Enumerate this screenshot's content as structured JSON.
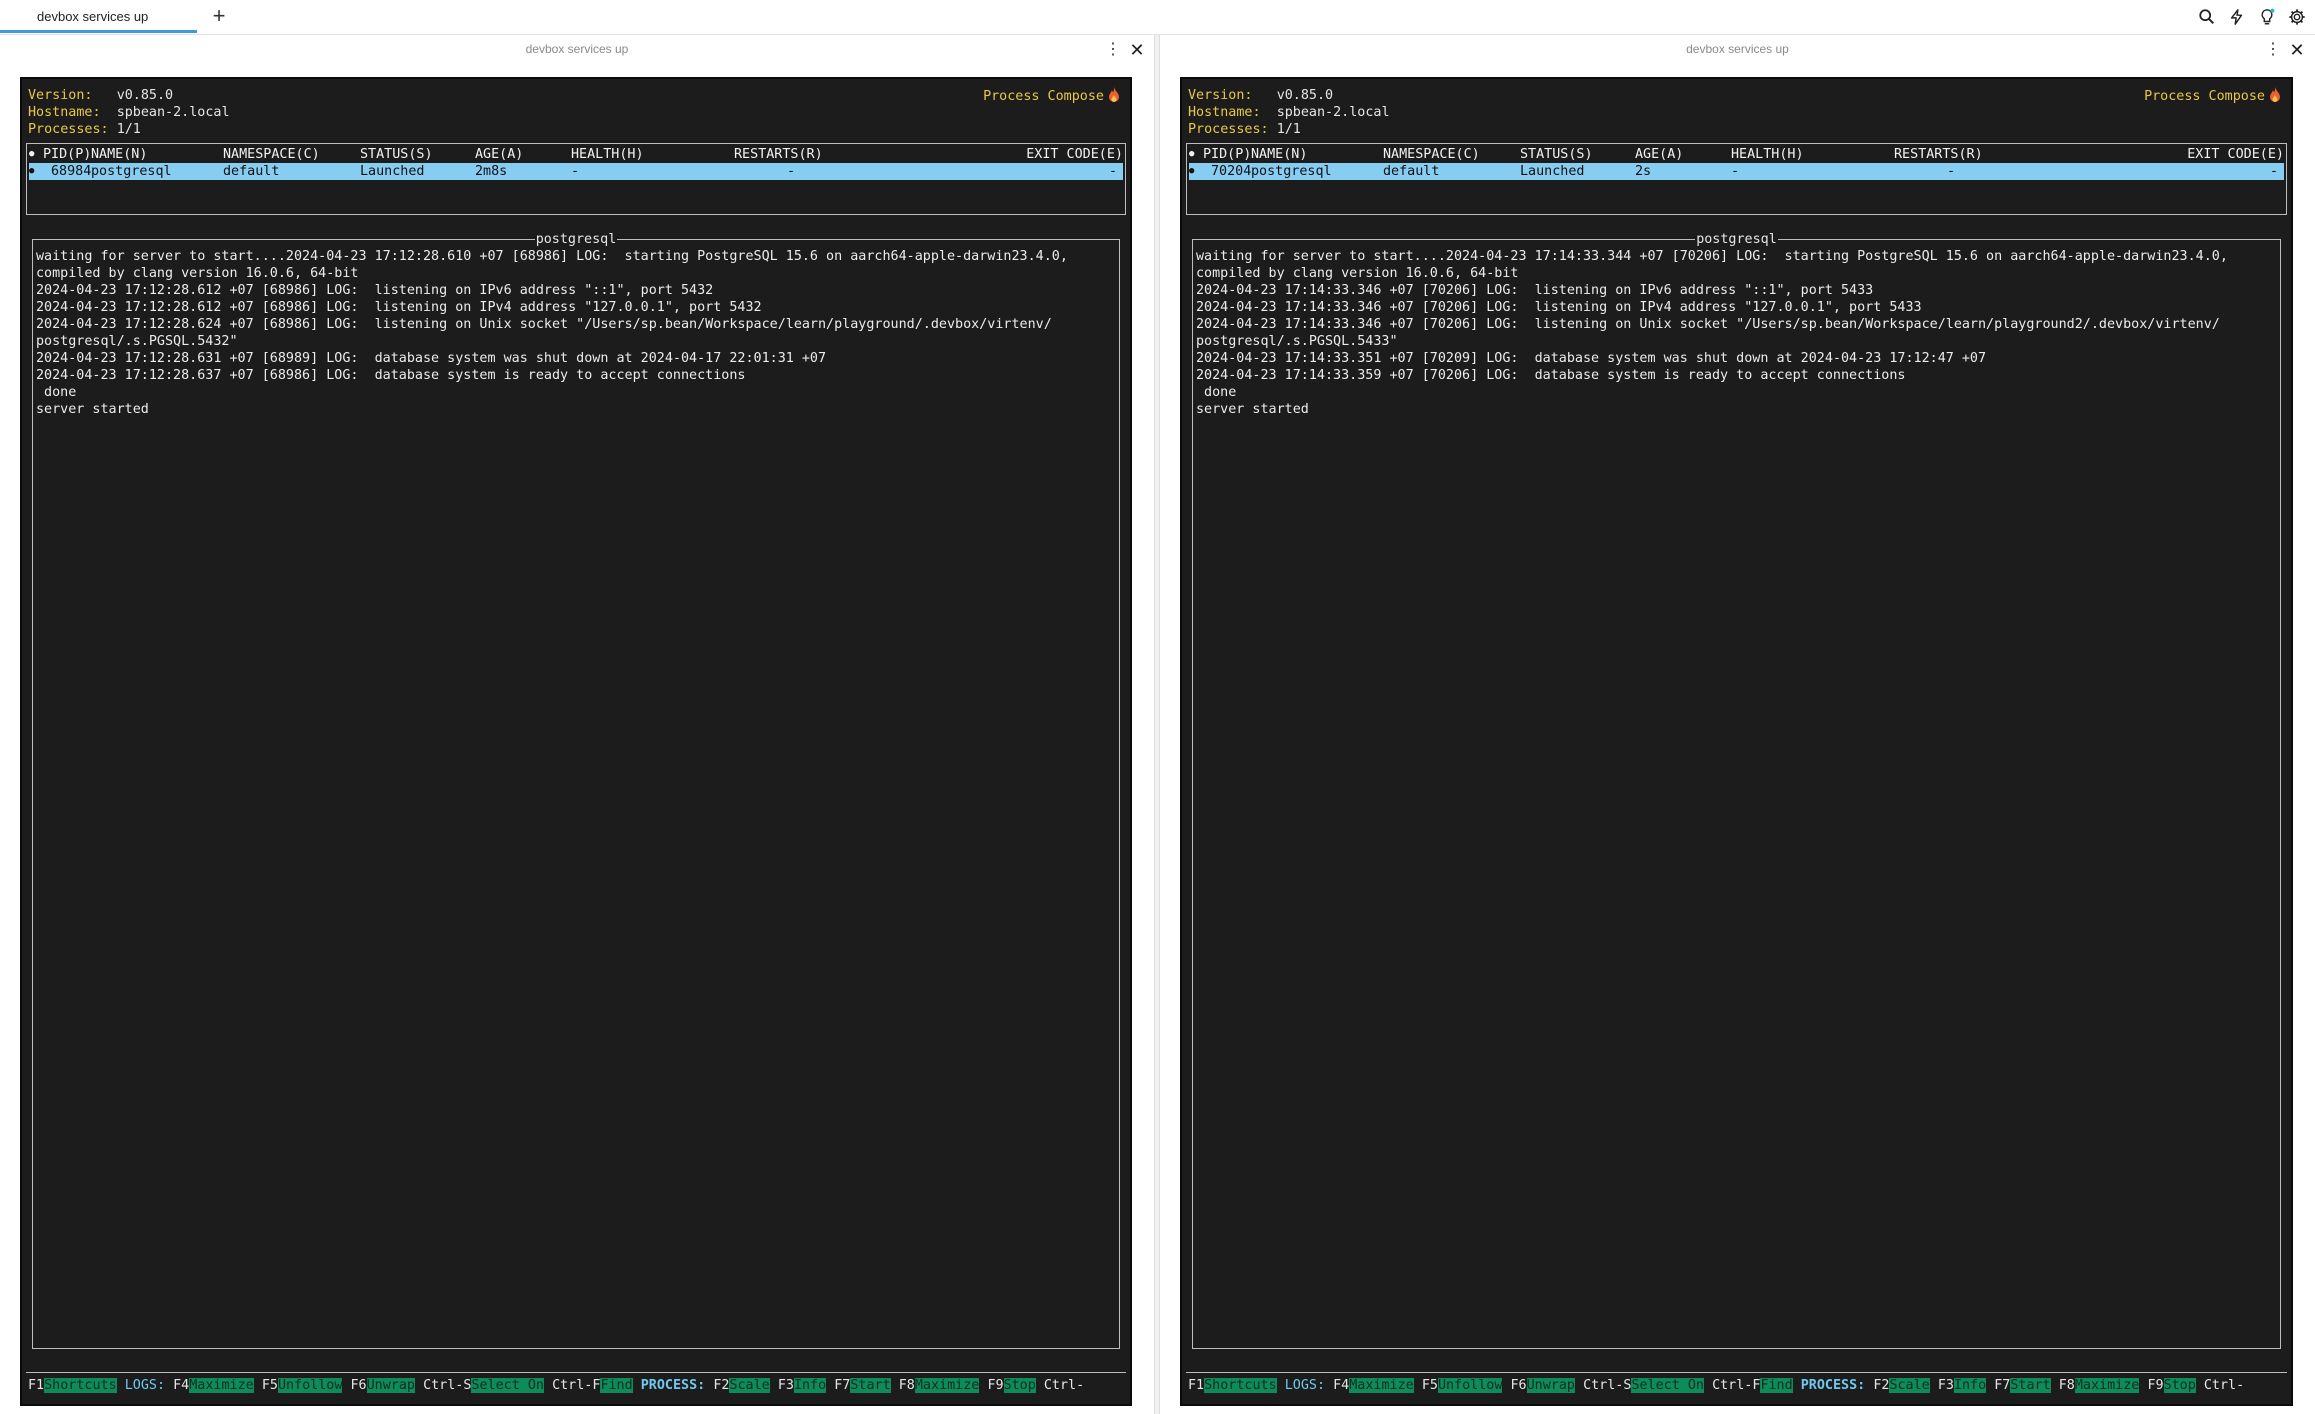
{
  "tabbar": {
    "tab_title": "devbox services up",
    "new_tab": "+",
    "icons": [
      "search-icon",
      "bolt-icon",
      "lightbulb-icon",
      "gear-icon"
    ]
  },
  "colors": {
    "accent": "#3d9bd9",
    "highlight_row": "#87cdf2",
    "key_label": "#e8c848",
    "footer_value_bg": "#0f8a5b"
  },
  "panes": [
    {
      "title": "devbox services up",
      "menu": "⋮",
      "close": "✕",
      "header": {
        "version_label": "Version:",
        "version": "v0.85.0",
        "hostname_label": "Hostname:",
        "hostname": "spbean-2.local",
        "processes_label": "Processes:",
        "processes": "1/1",
        "brand": "Process Compose"
      },
      "table": {
        "columns": [
          "PID(P)",
          "NAME(N)",
          "NAMESPACE(C)",
          "STATUS(S)",
          "AGE(A)",
          "HEALTH(H)",
          "RESTARTS(R)",
          "EXIT CODE(E)"
        ],
        "rows": [
          {
            "pid": "68984",
            "name": "postgresql",
            "namespace": "default",
            "status": "Launched",
            "age": "2m8s",
            "health": "-",
            "restarts": "-",
            "exit_code": "-"
          }
        ]
      },
      "log_title": "postgresql",
      "log_lines": [
        "waiting for server to start....2024-04-23 17:12:28.610 +07 [68986] LOG:  starting PostgreSQL 15.6 on aarch64-apple-darwin23.4.0,",
        "compiled by clang version 16.0.6, 64-bit",
        "2024-04-23 17:12:28.612 +07 [68986] LOG:  listening on IPv6 address \"::1\", port 5432",
        "2024-04-23 17:12:28.612 +07 [68986] LOG:  listening on IPv4 address \"127.0.0.1\", port 5432",
        "2024-04-23 17:12:28.624 +07 [68986] LOG:  listening on Unix socket \"/Users/sp.bean/Workspace/learn/playground/.devbox/virtenv/",
        "postgresql/.s.PGSQL.5432\"",
        "2024-04-23 17:12:28.631 +07 [68989] LOG:  database system was shut down at 2024-04-17 22:01:31 +07",
        "2024-04-23 17:12:28.637 +07 [68986] LOG:  database system is ready to accept connections",
        " done",
        "server started"
      ]
    },
    {
      "title": "devbox services up",
      "menu": "⋮",
      "close": "✕",
      "header": {
        "version_label": "Version:",
        "version": "v0.85.0",
        "hostname_label": "Hostname:",
        "hostname": "spbean-2.local",
        "processes_label": "Processes:",
        "processes": "1/1",
        "brand": "Process Compose"
      },
      "table": {
        "columns": [
          "PID(P)",
          "NAME(N)",
          "NAMESPACE(C)",
          "STATUS(S)",
          "AGE(A)",
          "HEALTH(H)",
          "RESTARTS(R)",
          "EXIT CODE(E)"
        ],
        "rows": [
          {
            "pid": "70204",
            "name": "postgresql",
            "namespace": "default",
            "status": "Launched",
            "age": "2s",
            "health": "-",
            "restarts": "-",
            "exit_code": "-"
          }
        ]
      },
      "log_title": "postgresql",
      "log_lines": [
        "waiting for server to start....2024-04-23 17:14:33.344 +07 [70206] LOG:  starting PostgreSQL 15.6 on aarch64-apple-darwin23.4.0,",
        "compiled by clang version 16.0.6, 64-bit",
        "2024-04-23 17:14:33.346 +07 [70206] LOG:  listening on IPv6 address \"::1\", port 5433",
        "2024-04-23 17:14:33.346 +07 [70206] LOG:  listening on IPv4 address \"127.0.0.1\", port 5433",
        "2024-04-23 17:14:33.346 +07 [70206] LOG:  listening on Unix socket \"/Users/sp.bean/Workspace/learn/playground2/.devbox/virtenv/",
        "postgresql/.s.PGSQL.5433\"",
        "2024-04-23 17:14:33.351 +07 [70209] LOG:  database system was shut down at 2024-04-23 17:12:47 +07",
        "2024-04-23 17:14:33.359 +07 [70206] LOG:  database system is ready to accept connections",
        " done",
        "server started"
      ]
    }
  ],
  "footer": {
    "items": [
      {
        "type": "key",
        "text": "F1"
      },
      {
        "type": "val",
        "text": "Shortcuts"
      },
      {
        "type": "gap",
        "text": " "
      },
      {
        "type": "sec",
        "text": "LOGS:"
      },
      {
        "type": "gap",
        "text": " "
      },
      {
        "type": "key",
        "text": "F4"
      },
      {
        "type": "val",
        "text": "Maximize"
      },
      {
        "type": "gap",
        "text": " "
      },
      {
        "type": "key",
        "text": "F5"
      },
      {
        "type": "val",
        "text": "Unfollow"
      },
      {
        "type": "gap",
        "text": " "
      },
      {
        "type": "key",
        "text": "F6"
      },
      {
        "type": "val",
        "text": "Unwrap"
      },
      {
        "type": "gap",
        "text": " "
      },
      {
        "type": "key",
        "text": "Ctrl-S"
      },
      {
        "type": "val",
        "text": "Select On"
      },
      {
        "type": "gap",
        "text": " "
      },
      {
        "type": "key",
        "text": "Ctrl-F"
      },
      {
        "type": "val",
        "text": "Find"
      },
      {
        "type": "gap",
        "text": " "
      },
      {
        "type": "secb",
        "text": "PROCESS:"
      },
      {
        "type": "gap",
        "text": " "
      },
      {
        "type": "key",
        "text": "F2"
      },
      {
        "type": "val",
        "text": "Scale"
      },
      {
        "type": "gap",
        "text": " "
      },
      {
        "type": "key",
        "text": "F3"
      },
      {
        "type": "val",
        "text": "Info"
      },
      {
        "type": "gap",
        "text": " "
      },
      {
        "type": "key",
        "text": "F7"
      },
      {
        "type": "val",
        "text": "Start"
      },
      {
        "type": "gap",
        "text": " "
      },
      {
        "type": "key",
        "text": "F8"
      },
      {
        "type": "val",
        "text": "Maximize"
      },
      {
        "type": "gap",
        "text": " "
      },
      {
        "type": "key",
        "text": "F9"
      },
      {
        "type": "val",
        "text": "Stop"
      },
      {
        "type": "gap",
        "text": " "
      },
      {
        "type": "key",
        "text": "Ctrl-"
      }
    ]
  }
}
